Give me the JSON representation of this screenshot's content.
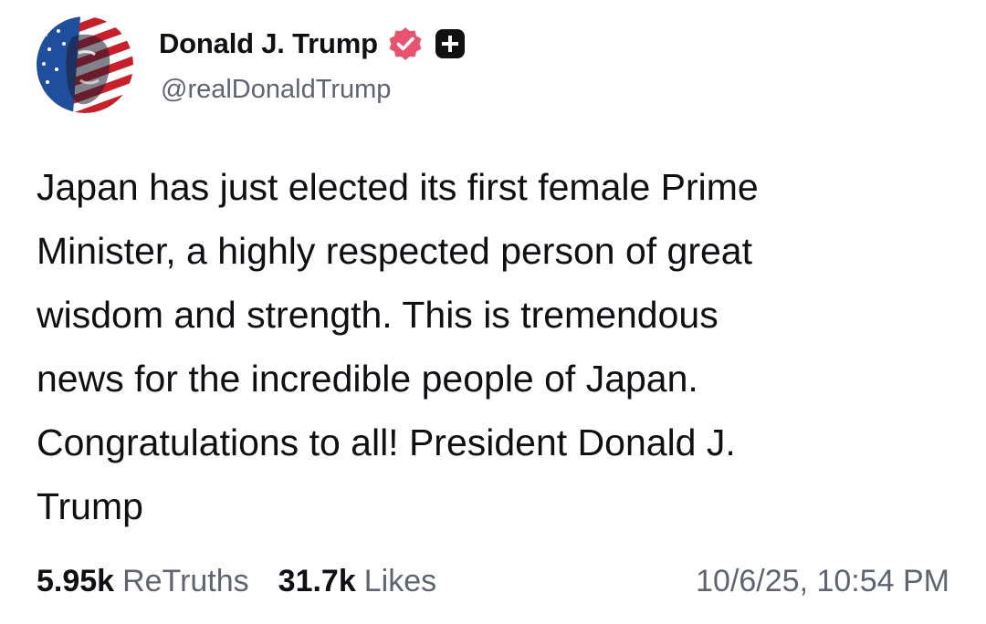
{
  "profile": {
    "display_name": "Donald J. Trump",
    "handle": "@realDonaldTrump",
    "avatar_icon": "profile-avatar",
    "verified_icon": "verified-badge-icon",
    "plus_icon": "plus-badge-icon"
  },
  "post": {
    "text": "Japan has just elected its first female Prime\nMinister, a highly respected person of great\nwisdom and strength. This is tremendous\nnews for the incredible people of Japan.\nCongratulations to all! President Donald J.\nTrump"
  },
  "stats": {
    "retruths_count": "5.95k",
    "retruths_label": "ReTruths",
    "likes_count": "31.7k",
    "likes_label": "Likes"
  },
  "timestamp": "10/6/25, 10:54 PM",
  "colors": {
    "text_primary": "#0f0f14",
    "text_secondary": "#5f6470",
    "verified_badge": "#e8546f",
    "plus_badge": "#111111"
  }
}
